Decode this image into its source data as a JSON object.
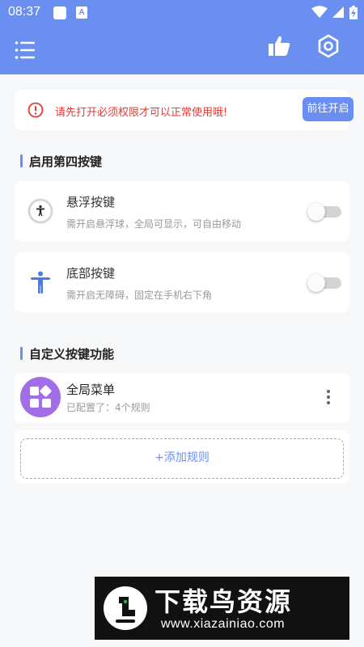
{
  "status_bar": {
    "time": "08:37",
    "a_icon": "A",
    "icons": [
      "notification-square-icon",
      "a-badge-icon",
      "wifi-icon",
      "signal-icon",
      "battery-charging-icon"
    ]
  },
  "app_bar": {
    "icons": [
      "menu-icon",
      "thumbs-up-icon",
      "settings-hexagon-icon"
    ],
    "color": "#6b8ff0"
  },
  "alert": {
    "message": "请先打开必须权限才可以正常使用哦!",
    "button_label": "前往开启",
    "icon": "error-circle-icon",
    "color": "#e53935"
  },
  "section_fourth_button": {
    "title": "启用第四按键"
  },
  "options": [
    {
      "title": "悬浮按键",
      "desc": "需开启悬浮球，全局可显示，可自由移动",
      "icon": "floating-accessibility-icon",
      "enabled": false
    },
    {
      "title": "底部按键",
      "desc": "需开启无障碍，固定在手机右下角",
      "icon": "accessibility-person-icon",
      "enabled": false
    }
  ],
  "section_custom": {
    "title": "自定义按键功能"
  },
  "rules": [
    {
      "title": "全局菜单",
      "subtitle": "已配置了：4个规则",
      "icon": "apps-grid-icon",
      "color": "#a26ee8"
    }
  ],
  "add_rule_label": "+添加规则",
  "watermark": {
    "name": "下载鸟资源",
    "url": "www.xiazainiao.com"
  }
}
